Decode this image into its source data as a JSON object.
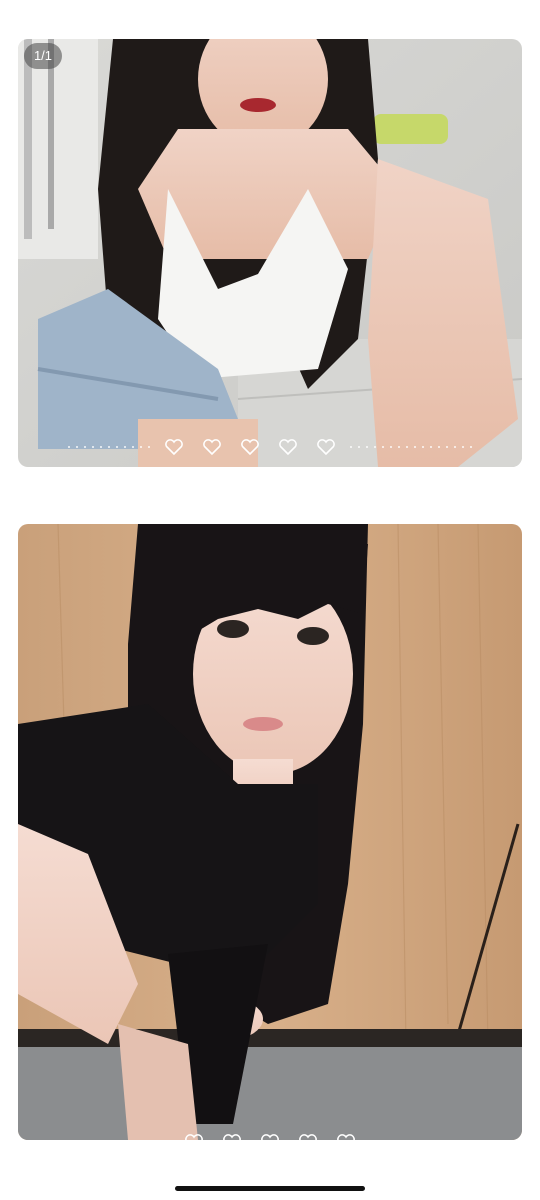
{
  "viewer": {
    "photo_counter": "1/1",
    "photos": [
      {
        "description_icon": "photo-selfie-white-top",
        "reactions": 5
      },
      {
        "description_icon": "photo-selfie-black-top",
        "reactions": 5
      }
    ]
  },
  "colors": {
    "background": "#ffffff",
    "badge": "#464646",
    "heart_outline": "#ffffff",
    "home_indicator": "#111111"
  }
}
